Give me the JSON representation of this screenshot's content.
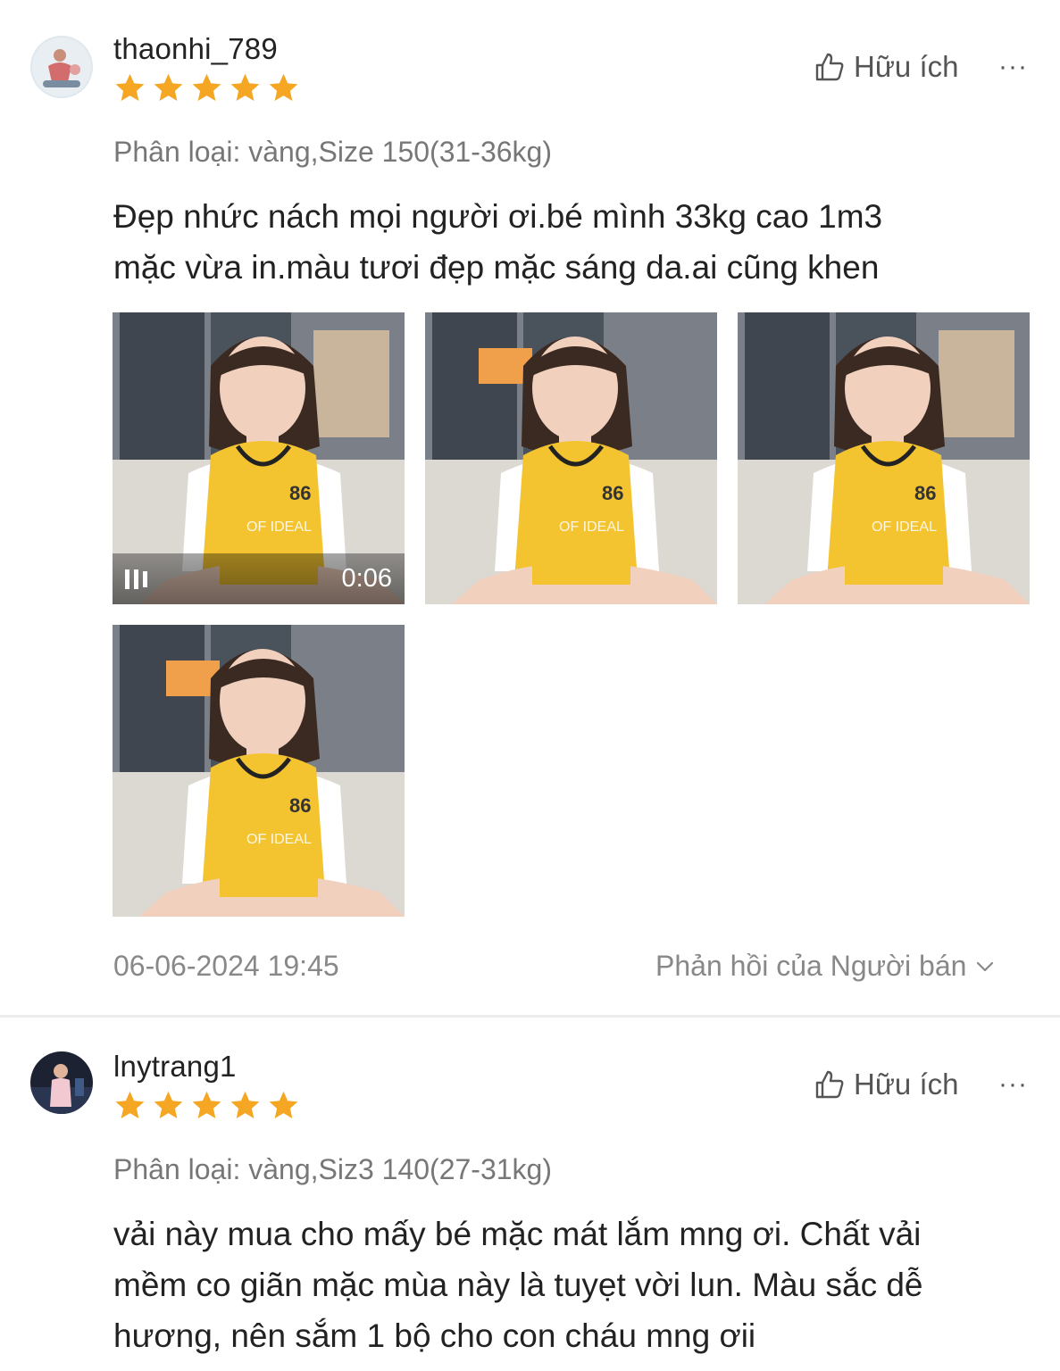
{
  "colors": {
    "star": "#f5a623",
    "jersey": "#f4c430",
    "text_muted": "#888888"
  },
  "reviews": [
    {
      "username": "thaonhi_789",
      "rating": 5,
      "variation": "Phân loại: vàng,Size 150(31-36kg)",
      "content_lines": [
        "Đẹp nhức nách mọi người ơi.bé mình 33kg cao 1m3",
        "mặc vừa in.màu tươi đẹp mặc sáng da.ai cũng khen"
      ],
      "helpful_label": "Hữu ích",
      "more_label": "···",
      "media": [
        {
          "type": "video",
          "duration": "0:06",
          "jersey_number": "86",
          "jersey_text": "OF IDEAL"
        },
        {
          "type": "image",
          "jersey_number": "86",
          "jersey_text": "OF IDEAL"
        },
        {
          "type": "image",
          "jersey_number": "86",
          "jersey_text": "OF IDEAL"
        },
        {
          "type": "image",
          "jersey_number": "86",
          "jersey_text": "OF IDEAL"
        }
      ],
      "date": "06-06-2024 19:45",
      "seller_reply_label": "Phản hồi của Người bán"
    },
    {
      "username": "lnytrang1",
      "rating": 5,
      "variation": "Phân loại: vàng,Siz3 140(27-31kg)",
      "content_lines": [
        "vải này mua cho mấy bé mặc mát lắm mng ơi. Chất vải",
        "mềm co giãn mặc mùa này là tuyẹt vời lun. Màu sắc dễ",
        "hương, nên sắm 1 bộ cho con cháu mng ơii"
      ],
      "helpful_label": "Hữu ích",
      "more_label": "···"
    }
  ]
}
